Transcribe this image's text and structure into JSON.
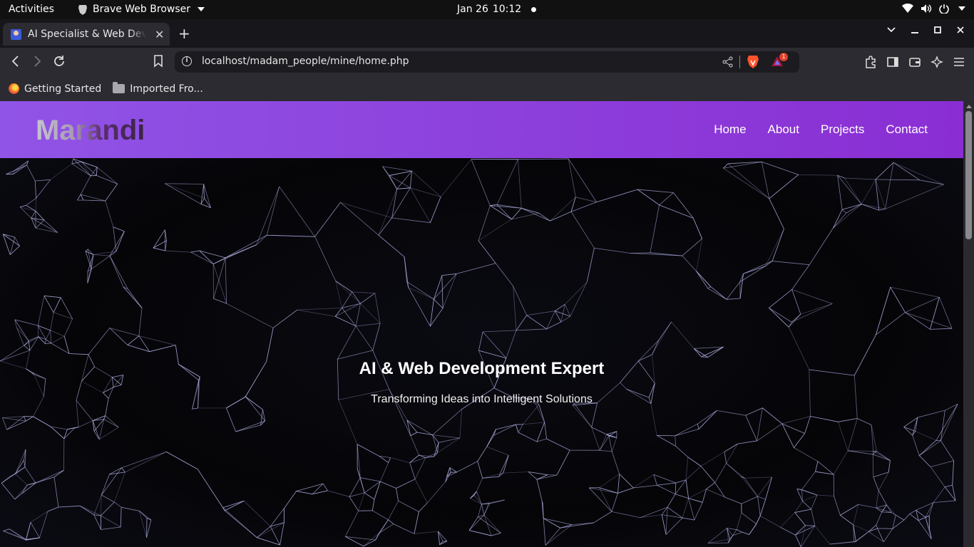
{
  "system_bar": {
    "activities": "Activities",
    "app_name": "Brave Web Browser",
    "date": "Jan 26",
    "time": "10:12"
  },
  "browser": {
    "tab_title": "AI Specialist & Web Developer",
    "url": "localhost/madam_people/mine/home.php",
    "rewards_badge": "1",
    "bookmarks": [
      "Getting Started",
      "Imported Fro..."
    ]
  },
  "site": {
    "logo": "Marandi",
    "nav": [
      "Home",
      "About",
      "Projects",
      "Contact"
    ],
    "hero_title": "AI & Web Development Expert",
    "hero_subtitle": "Transforming Ideas into Intelligent Solutions"
  },
  "colors": {
    "header_start": "#9054e6",
    "header_end": "#8a2ed3",
    "web_lines": "#b8b8ee"
  }
}
